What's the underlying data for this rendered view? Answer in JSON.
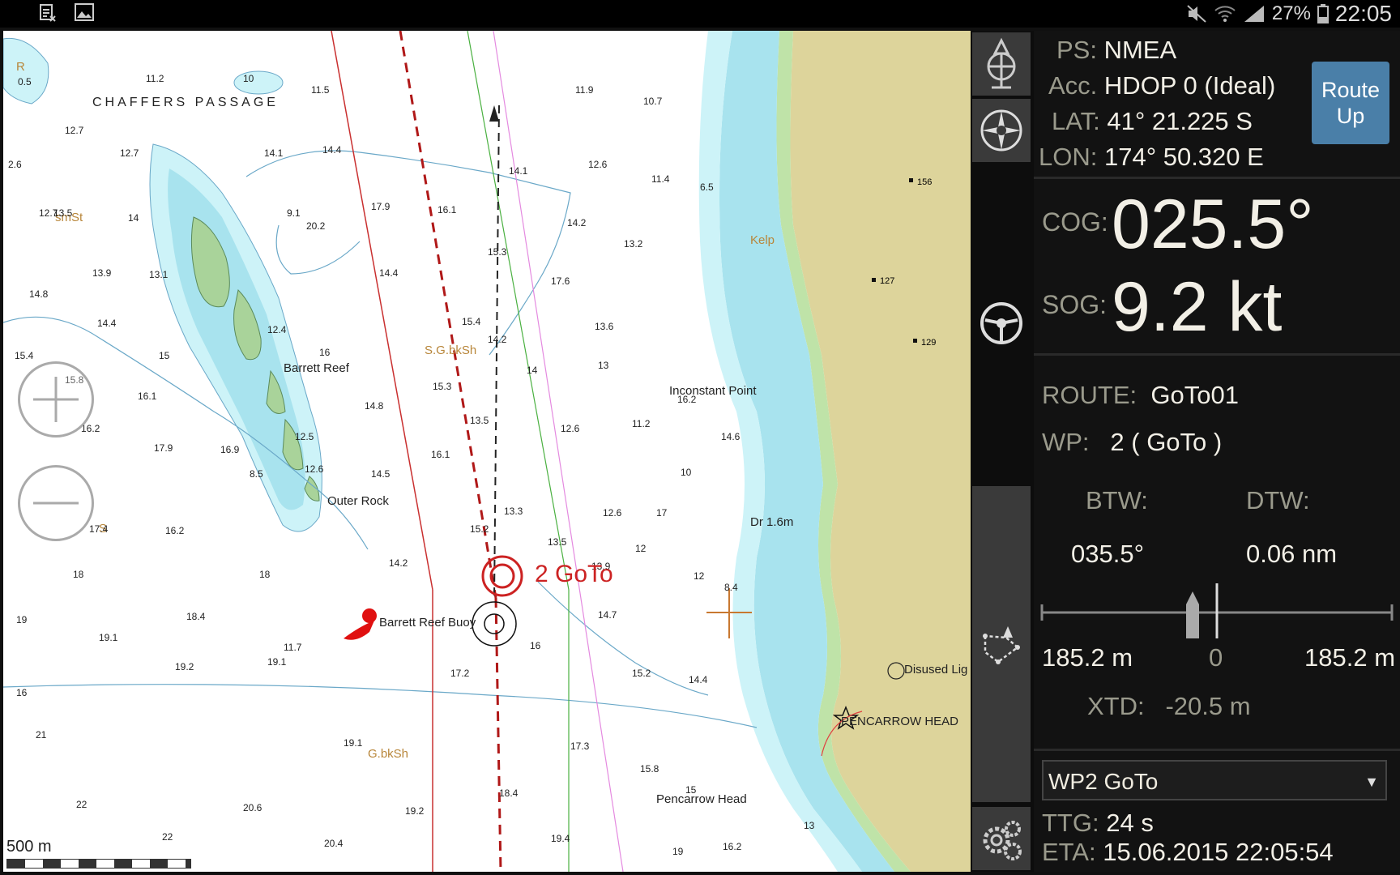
{
  "status_bar": {
    "left_icons": [
      "notification-icon",
      "image-icon"
    ],
    "right_icons": [
      "mute-icon",
      "wifi-icon",
      "signal-icon",
      "battery-icon"
    ],
    "battery": "27%",
    "time": "22:05"
  },
  "chart": {
    "labels": [
      {
        "text": "CHAFFERS PASSAGE",
        "style": "big"
      },
      {
        "text": "smSt",
        "style": "brown"
      },
      {
        "text": "Barrett Reef",
        "style": "normal"
      },
      {
        "text": "Outer Rock",
        "style": "normal"
      },
      {
        "text": "S.G.bkSh",
        "style": "brown"
      },
      {
        "text": "Kelp",
        "style": "brown"
      },
      {
        "text": "Inconstant Point",
        "style": "normal"
      },
      {
        "text": "Dr 1.6m",
        "style": "normal"
      },
      {
        "text": "Barrett Reef Buoy",
        "style": "normal"
      },
      {
        "text": "Disused Lig",
        "style": "normal"
      },
      {
        "text": "PENCARROW HEAD",
        "style": "normal"
      },
      {
        "text": "G.bkSh",
        "style": "brown"
      },
      {
        "text": "Pencarrow Head",
        "style": "normal"
      },
      {
        "text": "S",
        "style": "brown"
      },
      {
        "text": "R",
        "style": "brown"
      }
    ],
    "waypoint_label": "2 GoTo",
    "scale_label": "500 m",
    "soundings": [
      "0.5",
      "11.2",
      "10",
      "11.5",
      "11.9",
      "10.7",
      "12.7",
      "12.7",
      "14.1",
      "14.4",
      "12.6",
      "11.4",
      "14.1",
      "6.5",
      "12.7",
      "2.6",
      "13.5",
      "14",
      "9.1",
      "20.2",
      "17.9",
      "16.1",
      "14.2",
      "13.2",
      "15.3",
      "14.4",
      "17.6",
      "13.9",
      "13.1",
      "14.8",
      "14.4",
      "12.4",
      "15",
      "16",
      "15.4",
      "14.2",
      "13.6",
      "15.4",
      "14",
      "13",
      "15.8",
      "15.3",
      "16.1",
      "14.8",
      "13.5",
      "12.6",
      "11.2",
      "16.2",
      "16.2",
      "17.9",
      "16.9",
      "16.1",
      "14.5",
      "13.3",
      "12.6",
      "17",
      "17.4",
      "16.2",
      "15.2",
      "14.2",
      "13.9",
      "13.5",
      "12",
      "18",
      "18",
      "18.4",
      "19",
      "19.1",
      "19.2",
      "19.1",
      "17.2",
      "15.2",
      "14.4",
      "14.7",
      "16",
      "16",
      "21",
      "19.1",
      "17.3",
      "15.8",
      "15",
      "22",
      "20.6",
      "19.2",
      "18.4",
      "19.4",
      "22",
      "20.4",
      "19",
      "16.2",
      "13",
      "12",
      "8.4",
      "8.5",
      "12.5",
      "12.6",
      "14.6",
      "10",
      "11.7"
    ]
  },
  "toolbar": {
    "tools": [
      {
        "icon": "north-up-compass-icon"
      },
      {
        "icon": "compass-rose-icon"
      },
      {
        "icon": "steering-wheel-icon"
      },
      {
        "icon": "route-planner-icon"
      },
      {
        "icon": "settings-gears-icon"
      }
    ]
  },
  "gps": {
    "ps_label": "PS:",
    "ps_value": "NMEA",
    "acc_label": "Acc.",
    "acc_value": "HDOP 0 (Ideal)",
    "lat_label": "LAT:",
    "lat_value": "41° 21.225 S",
    "lon_label": "LON:",
    "lon_value": "174° 50.320 E",
    "route_up_line1": "Route",
    "route_up_line2": "Up"
  },
  "nav": {
    "cog_label": "COG:",
    "cog_value": "025.5°",
    "sog_label": "SOG:",
    "sog_value": "9.2 kt"
  },
  "route": {
    "route_label": "ROUTE:",
    "route_value": "GoTo01",
    "wp_label": "WP:",
    "wp_value": "2 ( GoTo )",
    "btw_label": "BTW:",
    "btw_value": "035.5°",
    "dtw_label": "DTW:",
    "dtw_value": "0.06 nm",
    "xtd_scale_left": "185.2 m",
    "xtd_scale_center": "0",
    "xtd_scale_right": "185.2 m",
    "xtd_label": "XTD:",
    "xtd_value": "-20.5 m"
  },
  "waypoint": {
    "selected": "WP2 GoTo",
    "ttg_label": "TTG:",
    "ttg_value": "24 s",
    "eta_label": "ETA:",
    "eta_value": "15.06.2015 22:05:54"
  }
}
